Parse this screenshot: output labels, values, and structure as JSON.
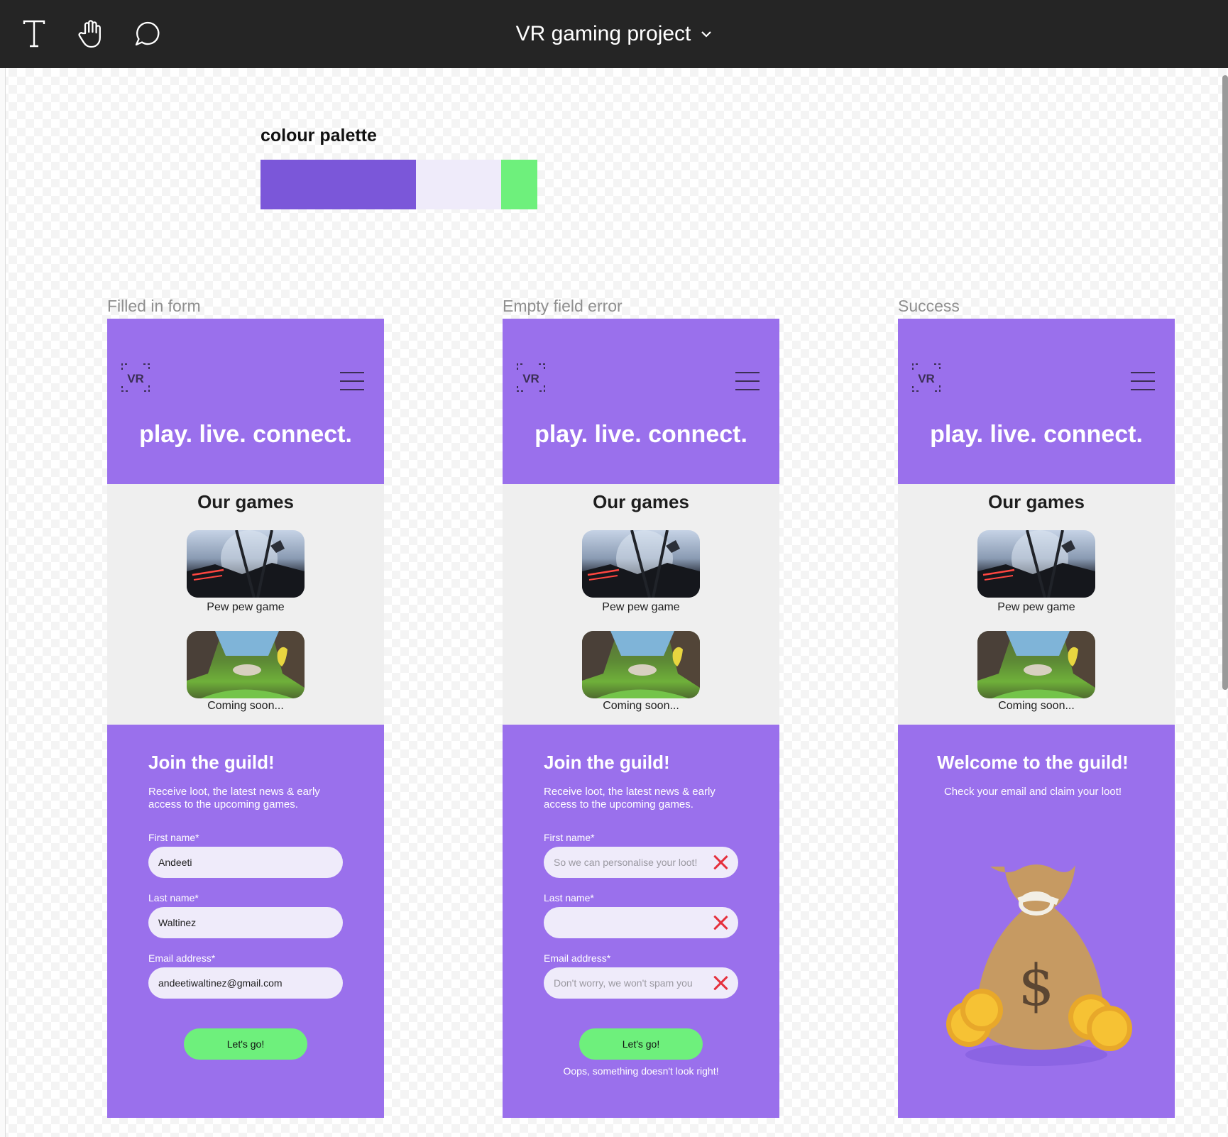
{
  "toolbar": {
    "tools": [
      "text-tool",
      "hand-tool",
      "comment-tool"
    ],
    "file_title": "VR gaming project"
  },
  "palette": {
    "title": "colour palette",
    "colors": [
      "#7b57d9",
      "#efebfa",
      "#6ef07c"
    ]
  },
  "frames": [
    {
      "label": "Filled in form",
      "tagline": "play. live. connect.",
      "games_title": "Our games",
      "games": [
        {
          "caption": "Pew pew game"
        },
        {
          "caption": "Coming soon..."
        }
      ],
      "join_title": "Join the guild!",
      "join_sub": "Receive loot, the latest news & early access to the upcoming games.",
      "fields": [
        {
          "label": "First name*",
          "value": "Andeeti"
        },
        {
          "label": "Last name*",
          "value": "Waltinez"
        },
        {
          "label": "Email address*",
          "value": "andeetiwaltinez@gmail.com"
        }
      ],
      "submit": "Let's go!"
    },
    {
      "label": "Empty field error",
      "tagline": "play. live. connect.",
      "games_title": "Our games",
      "games": [
        {
          "caption": "Pew pew game"
        },
        {
          "caption": "Coming soon..."
        }
      ],
      "join_title": "Join the guild!",
      "join_sub": "Receive loot, the latest news & early access to the upcoming games.",
      "fields": [
        {
          "label": "First name*",
          "placeholder": "So we can personalise your loot!"
        },
        {
          "label": "Last name*",
          "placeholder": ""
        },
        {
          "label": "Email address*",
          "placeholder": "Don't worry, we won't spam you"
        }
      ],
      "submit": "Let's go!",
      "error": "Oops, something doesn't look right!"
    },
    {
      "label": "Success",
      "tagline": "play. live. connect.",
      "games_title": "Our games",
      "games": [
        {
          "caption": "Pew pew game"
        },
        {
          "caption": "Coming soon..."
        }
      ],
      "welcome_title": "Welcome to the guild!",
      "welcome_sub": "Check your email and claim your loot!"
    }
  ]
}
